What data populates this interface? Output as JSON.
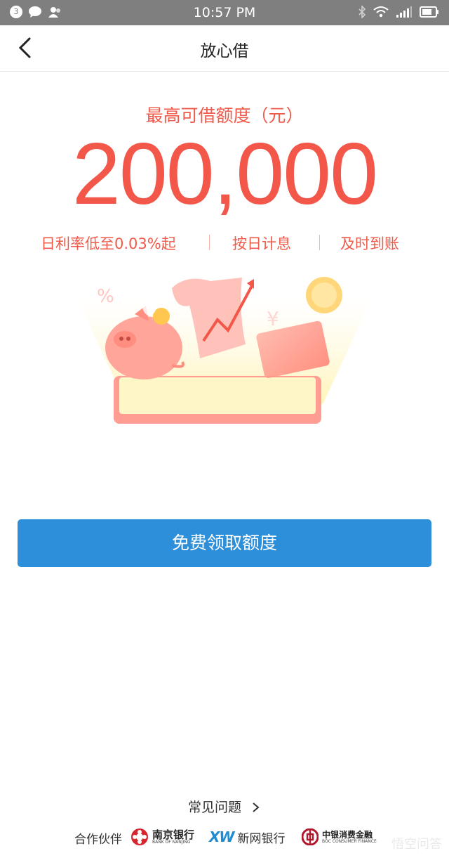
{
  "status_bar": {
    "notification_count": "3",
    "time": "10:57 PM"
  },
  "header": {
    "title": "放心借"
  },
  "hero": {
    "limit_label": "最高可借额度（元）",
    "amount": "200,000",
    "features": [
      "日利率低至0.03%起",
      "按日计息",
      "及时到账"
    ]
  },
  "cta": {
    "label": "免费领取额度"
  },
  "footer": {
    "faq_label": "常见问题",
    "partners_label": "合作伙伴",
    "partners": [
      {
        "name": "南京银行",
        "subtitle": "BANK OF NANJING"
      },
      {
        "mark": "XW",
        "name": "新网银行"
      },
      {
        "name": "中银消费金融",
        "subtitle": "BOC CONSUMER FINANCE"
      }
    ]
  },
  "watermark": "悟空问答",
  "colors": {
    "accent_red": "#f2574a",
    "button_blue": "#2d8fd9",
    "status_bar_gray": "#7f7f7f"
  }
}
